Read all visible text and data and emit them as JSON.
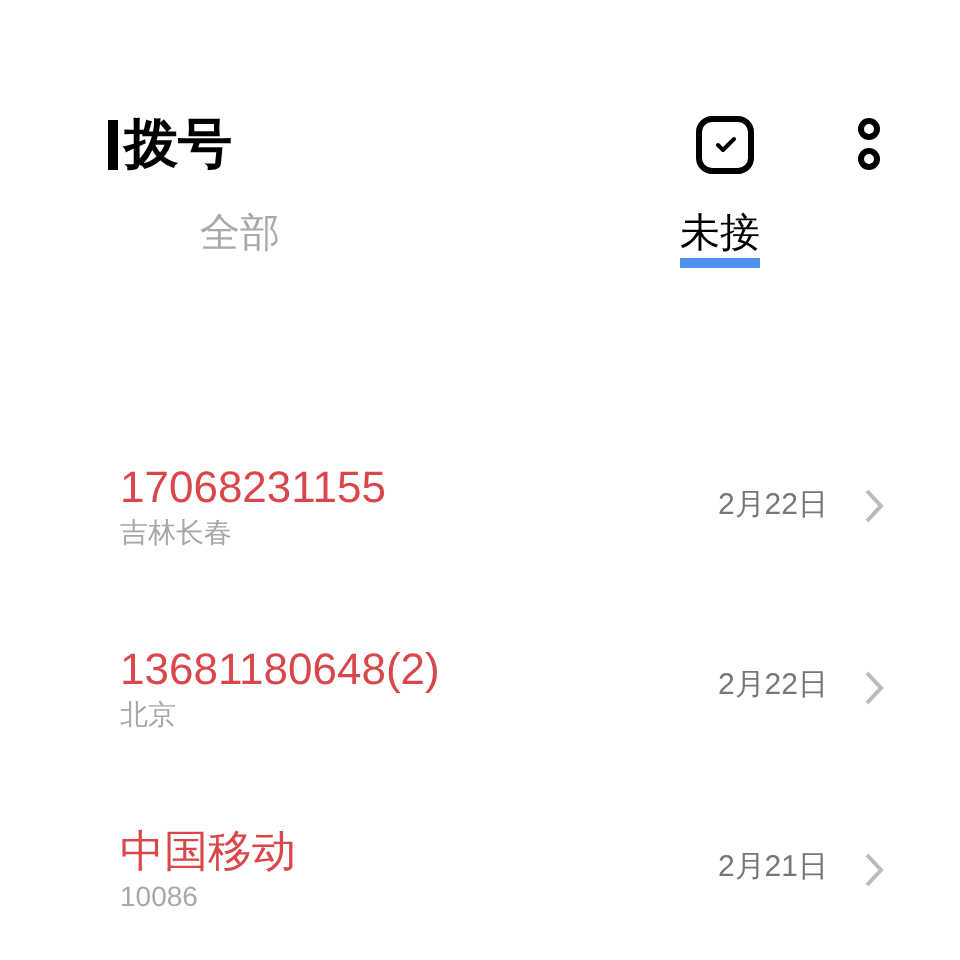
{
  "header": {
    "title": "拨号"
  },
  "tabs": [
    {
      "label": "全部",
      "selected": false
    },
    {
      "label": "未接",
      "selected": true
    }
  ],
  "calls": [
    {
      "name": "17068231155",
      "detail": "吉林长春",
      "date": "2月22日",
      "missed": true
    },
    {
      "name": "13681180648(2)",
      "detail": "北京",
      "date": "2月22日",
      "missed": true
    },
    {
      "name": "中国移动",
      "detail": "10086",
      "date": "2月21日",
      "missed": true
    }
  ]
}
